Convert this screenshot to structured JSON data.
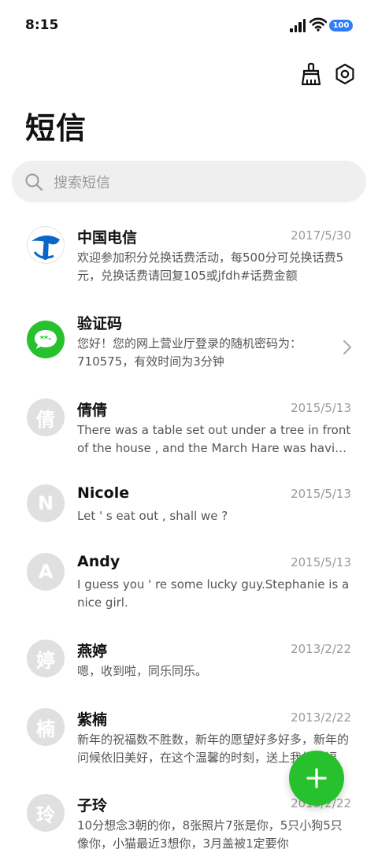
{
  "status_bar": {
    "time": "8:15",
    "battery": "100"
  },
  "header": {
    "title": "短信"
  },
  "search": {
    "placeholder": "搜索短信"
  },
  "conversations": [
    {
      "name": "中国电信",
      "date": "2017/5/30",
      "preview": "欢迎参加积分兑换话费活动，每500分可兑换话费5元，兑换话费请回复105或jfdh#话费金额",
      "avatar_type": "china-telecom-logo"
    },
    {
      "name": "验证码",
      "date": "",
      "preview": "您好！您的网上营业厅登录的随机密码为：710575，有效时间为3分钟",
      "avatar_type": "message-bubble"
    },
    {
      "name": "倩倩",
      "date": "2015/5/13",
      "preview": "There was a table set out under a tree in front of the house , and the March Hare was having tea",
      "avatar_letter": "倩"
    },
    {
      "name": "Nicole",
      "date": "2015/5/13",
      "preview": "Let ' s eat out , shall we ?",
      "avatar_letter": "N"
    },
    {
      "name": "Andy",
      "date": "2015/5/13",
      "preview": "I guess you ' re some lucky guy.Stephanie is a nice girl.",
      "avatar_letter": "A"
    },
    {
      "name": "燕婷",
      "date": "2013/2/22",
      "preview": "嗯，收到啦，同乐同乐。",
      "avatar_letter": "婷"
    },
    {
      "name": "紫楠",
      "date": "2013/2/22",
      "preview": "新年的祝福数不胜数，新年的愿望好多好多，新年的问候依旧美好，在这个温馨的时刻，送上我的祝福",
      "avatar_letter": "楠"
    },
    {
      "name": "子玲",
      "date": "2013/2/22",
      "preview": "10分想念3朝的你，8张照片7张是你，5只小狗5只像你，小猫最近3想你，3月盖被1定要你",
      "avatar_letter": "玲"
    }
  ],
  "colors": {
    "accent": "#27c12e",
    "battery": "#2f7cf6",
    "telecom_blue": "#0a66c9"
  },
  "icons": {
    "clean": "broom-icon",
    "settings": "hexagon-settings-icon",
    "fab": "plus-icon"
  }
}
